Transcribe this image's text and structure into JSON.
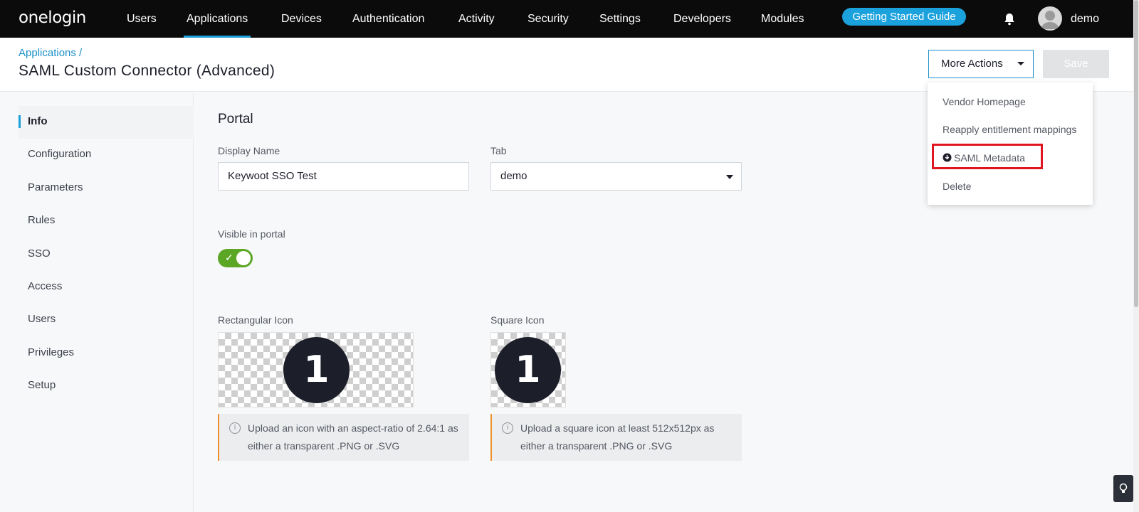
{
  "brand": "onelogin",
  "nav": {
    "items": [
      "Users",
      "Applications",
      "Devices",
      "Authentication",
      "Activity",
      "Security",
      "Settings",
      "Developers",
      "Modules"
    ],
    "active": "Applications",
    "guide_label": "Getting Started Guide",
    "user_name": "demo"
  },
  "header": {
    "breadcrumb": "Applications /",
    "title": "SAML Custom Connector (Advanced)",
    "more_actions_label": "More Actions",
    "save_label": "Save"
  },
  "menu": {
    "items": [
      "Vendor Homepage",
      "Reapply entitlement mappings",
      "SAML Metadata",
      "Delete"
    ]
  },
  "sidebar": {
    "items": [
      "Info",
      "Configuration",
      "Parameters",
      "Rules",
      "SSO",
      "Access",
      "Users",
      "Privileges",
      "Setup"
    ],
    "active": "Info"
  },
  "portal": {
    "section_title": "Portal",
    "display_name_label": "Display Name",
    "display_name_value": "Keywoot SSO Test",
    "tab_label": "Tab",
    "tab_value": "demo",
    "visible_label": "Visible in portal",
    "visible": true,
    "rect_icon_label": "Rectangular Icon",
    "square_icon_label": "Square Icon",
    "icon_glyph": "1",
    "rect_hint": "Upload an icon with an aspect-ratio of 2.64:1 as either a transparent .PNG or .SVG",
    "square_hint": "Upload a square icon at least 512x512px as either a transparent .PNG or .SVG"
  },
  "colors": {
    "accent": "#1a9fd9",
    "toggle_on": "#5ca626",
    "highlight": "#e0151f",
    "warning": "#f0902b"
  }
}
